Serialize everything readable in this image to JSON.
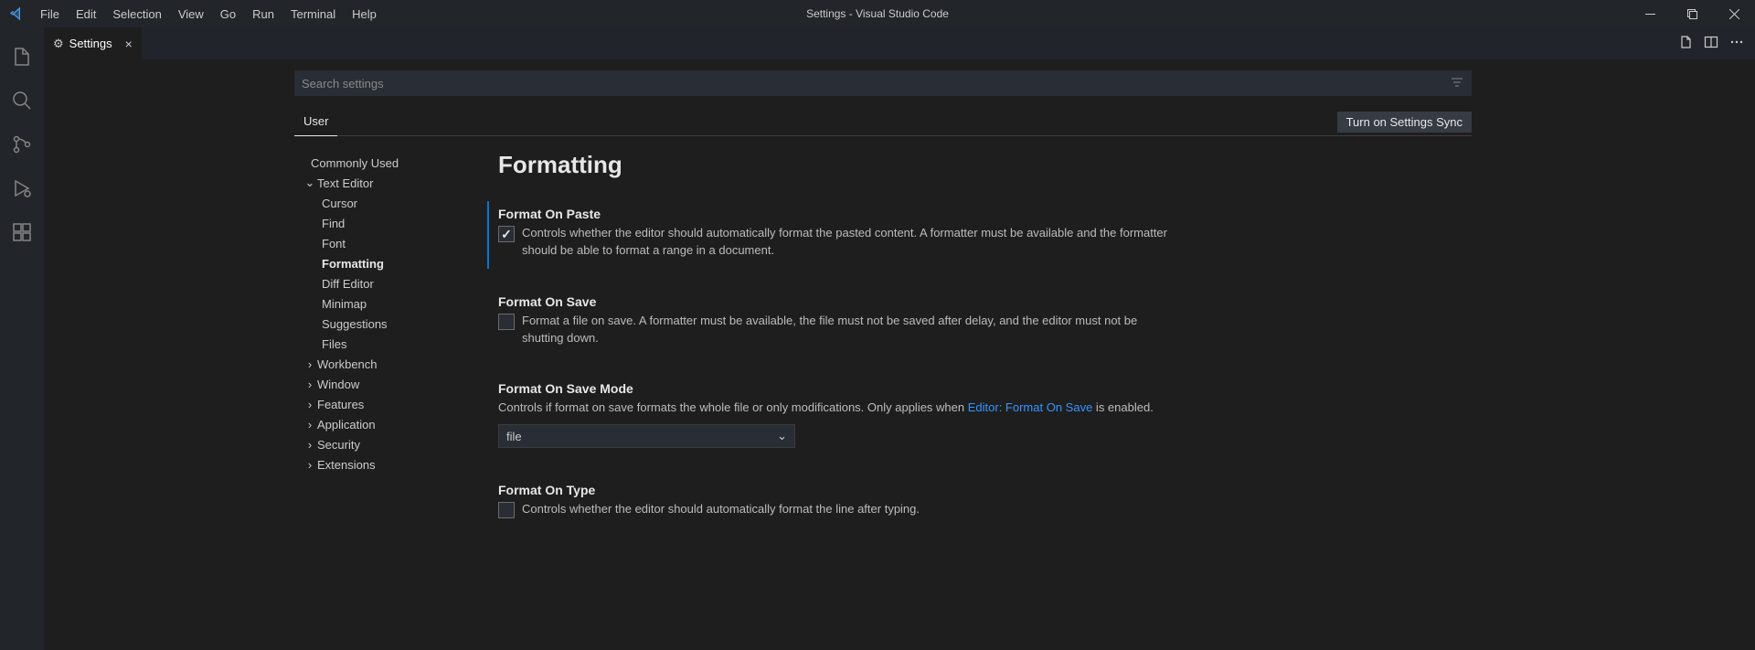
{
  "titlebar": {
    "menus": [
      "File",
      "Edit",
      "Selection",
      "View",
      "Go",
      "Run",
      "Terminal",
      "Help"
    ],
    "title": "Settings - Visual Studio Code"
  },
  "tab": {
    "label": "Settings"
  },
  "search": {
    "placeholder": "Search settings"
  },
  "scope": {
    "user": "User",
    "sync_button": "Turn on Settings Sync"
  },
  "toc": {
    "commonly_used": "Commonly Used",
    "text_editor": "Text Editor",
    "cursor": "Cursor",
    "find": "Find",
    "font": "Font",
    "formatting": "Formatting",
    "diff_editor": "Diff Editor",
    "minimap": "Minimap",
    "suggestions": "Suggestions",
    "files": "Files",
    "workbench": "Workbench",
    "window": "Window",
    "features": "Features",
    "application": "Application",
    "security": "Security",
    "extensions": "Extensions"
  },
  "section": {
    "heading": "Formatting"
  },
  "settings": {
    "format_on_paste": {
      "title": "Format On Paste",
      "desc": "Controls whether the editor should automatically format the pasted content. A formatter must be available and the formatter should be able to format a range in a document."
    },
    "format_on_save": {
      "title": "Format On Save",
      "desc": "Format a file on save. A formatter must be available, the file must not be saved after delay, and the editor must not be shutting down."
    },
    "format_on_save_mode": {
      "title": "Format On Save Mode",
      "desc_pre": "Controls if format on save formats the whole file or only modifications. Only applies when ",
      "desc_link": "Editor: Format On Save",
      "desc_post": " is enabled.",
      "value": "file"
    },
    "format_on_type": {
      "title": "Format On Type",
      "desc": "Controls whether the editor should automatically format the line after typing."
    }
  }
}
